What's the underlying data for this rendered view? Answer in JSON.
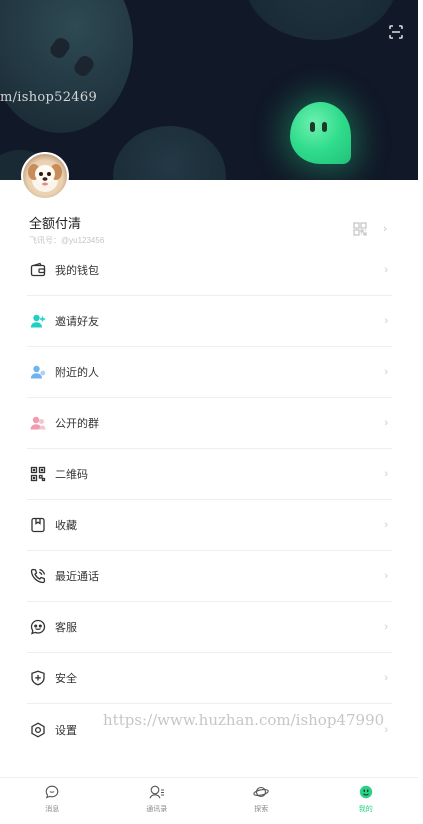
{
  "header": {
    "watermark": "m/ishop52469",
    "scan_icon": "scan-icon",
    "avatar_icon": "puppy-avatar"
  },
  "profile": {
    "name": "全额付清",
    "id_label": "飞讯号：@yu123456",
    "qr_icon": "qr-code-icon",
    "chevron": "›"
  },
  "menu": {
    "items": [
      {
        "label": "我的钱包",
        "icon": "wallet-icon"
      },
      {
        "label": "邀请好友",
        "icon": "invite-friend-icon"
      },
      {
        "label": "附近的人",
        "icon": "nearby-people-icon"
      },
      {
        "label": "公开的群",
        "icon": "public-group-icon"
      },
      {
        "label": "二维码",
        "icon": "qr-code-icon"
      },
      {
        "label": "收藏",
        "icon": "bookmark-icon"
      },
      {
        "label": "最近通话",
        "icon": "phone-icon"
      },
      {
        "label": "客服",
        "icon": "customer-service-icon"
      },
      {
        "label": "安全",
        "icon": "shield-icon"
      },
      {
        "label": "设置",
        "icon": "settings-icon"
      }
    ],
    "chevron": "›"
  },
  "watermark_bottom": "https://www.huzhan.com/ishop47990",
  "tabbar": {
    "tabs": [
      {
        "label": "消息",
        "icon": "message-icon",
        "active": false
      },
      {
        "label": "通讯录",
        "icon": "contacts-icon",
        "active": false
      },
      {
        "label": "探索",
        "icon": "planet-icon",
        "active": false
      },
      {
        "label": "我的",
        "icon": "me-icon",
        "active": true
      }
    ]
  },
  "colors": {
    "accent": "#2bd186",
    "header_bg": "#111827",
    "invite_icon": "#1fd0c6",
    "nearby_icon": "#6fb4f0",
    "group_icon": "#f29aae"
  }
}
